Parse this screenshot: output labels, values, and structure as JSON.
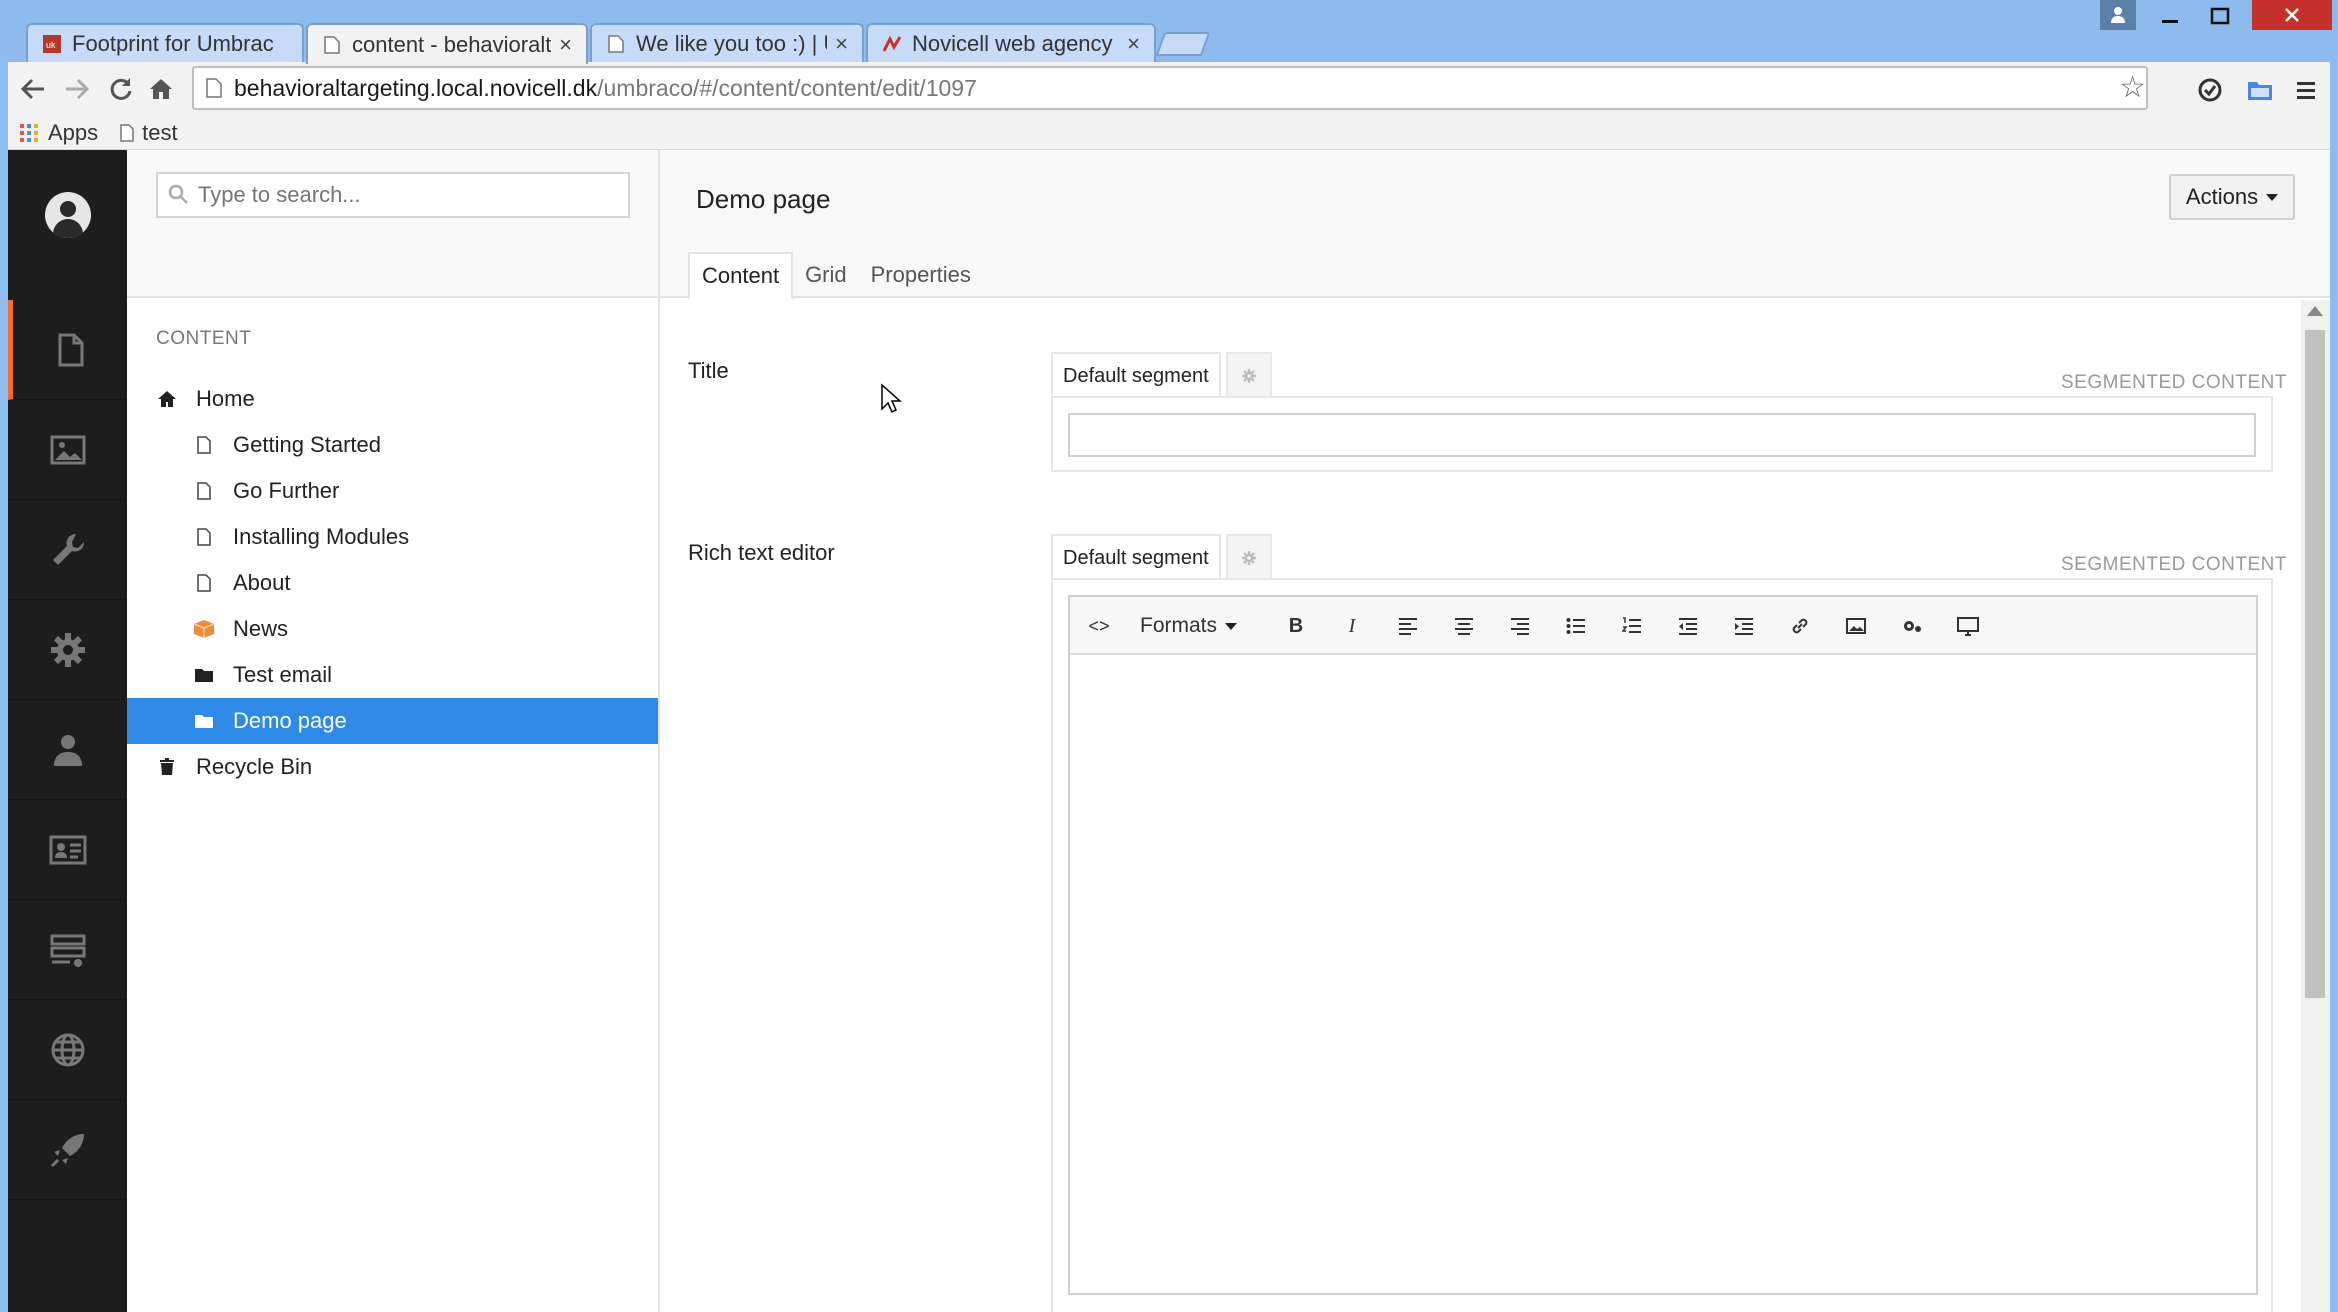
{
  "browser": {
    "tabs": [
      {
        "title": "Footprint for Umbrac",
        "favicon": "umbraco-footprint-icon"
      },
      {
        "title": "content - behavioralt",
        "favicon": "page-icon"
      },
      {
        "title": "We like you too :) | U",
        "favicon": "page-icon"
      },
      {
        "title": "Novicell web agency",
        "favicon": "novicell-icon"
      }
    ],
    "close_glyph": "×",
    "url_host": "behavioraltargeting.local.novicell.dk",
    "url_path": "/umbraco/#/content/content/edit/1097",
    "bookmarks": [
      {
        "label": "Apps"
      },
      {
        "label": "test"
      }
    ]
  },
  "tree": {
    "search_placeholder": "Type to search...",
    "section_title": "CONTENT",
    "nodes": [
      {
        "label": "Home",
        "icon": "home-icon"
      },
      {
        "label": "Getting Started",
        "icon": "document-icon"
      },
      {
        "label": "Go Further",
        "icon": "document-icon"
      },
      {
        "label": "Installing Modules",
        "icon": "document-icon"
      },
      {
        "label": "About",
        "icon": "document-icon"
      },
      {
        "label": "News",
        "icon": "news-package-icon"
      },
      {
        "label": "Test email",
        "icon": "folder-icon"
      },
      {
        "label": "Demo page",
        "icon": "folder-icon",
        "selected": true
      },
      {
        "label": "Recycle Bin",
        "icon": "trash-icon"
      }
    ]
  },
  "editor": {
    "page_title": "Demo page",
    "actions_label": "Actions",
    "tabs": [
      {
        "label": "Content",
        "active": true
      },
      {
        "label": "Grid"
      },
      {
        "label": "Properties"
      }
    ],
    "properties": [
      {
        "label": "Title",
        "segment_tab": "Default segment",
        "badge": "SEGMENTED CONTENT",
        "value": ""
      },
      {
        "label": "Rich text editor",
        "segment_tab": "Default segment",
        "badge": "SEGMENTED CONTENT"
      }
    ],
    "rte": {
      "formats_label": "Formats",
      "source_glyph": "<>",
      "bold_glyph": "B",
      "italic_glyph": "I"
    }
  },
  "colors": {
    "accent_selected": "#2e8ae6",
    "rail_active": "#f36f21",
    "rail_bg": "#1d1d1d"
  }
}
